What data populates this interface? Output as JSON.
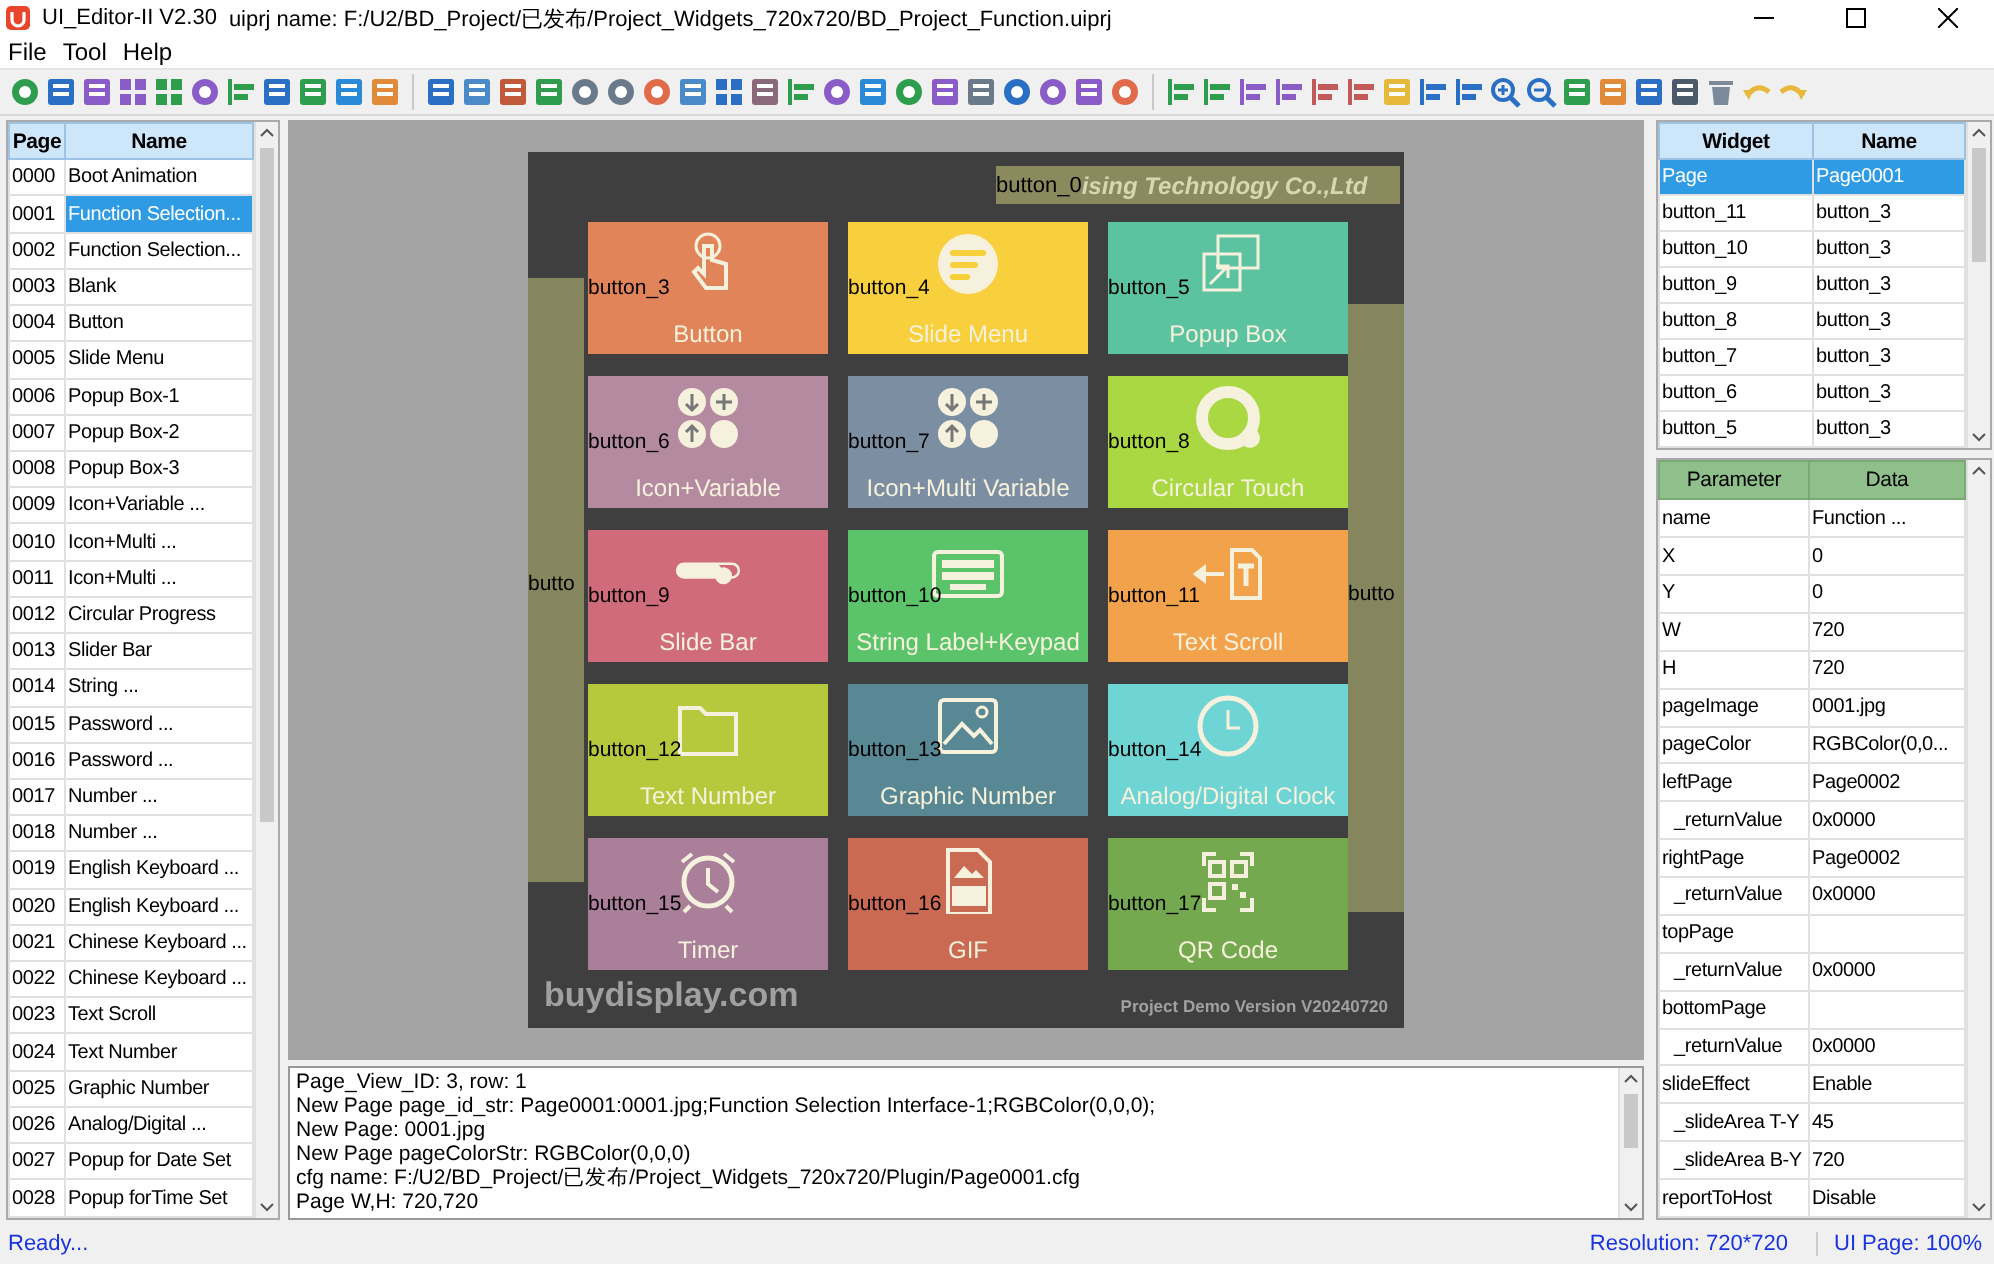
{
  "window": {
    "title": "UI_Editor-II V2.30",
    "project": "uiprj name: F:/U2/BD_Project/已发布/Project_Widgets_720x720/BD_Project_Function.uiprj"
  },
  "menu": [
    "File",
    "Tool",
    "Help"
  ],
  "pages": {
    "columns": [
      "Page",
      "Name"
    ],
    "rows": [
      {
        "page": "0000",
        "name": "Boot Animation",
        "selected": false
      },
      {
        "page": "0001",
        "name": "Function Selection...",
        "selected": true
      },
      {
        "page": "0002",
        "name": "Function Selection...",
        "selected": false
      },
      {
        "page": "0003",
        "name": "Blank",
        "selected": false
      },
      {
        "page": "0004",
        "name": "Button",
        "selected": false
      },
      {
        "page": "0005",
        "name": "Slide Menu",
        "selected": false
      },
      {
        "page": "0006",
        "name": "Popup  Box-1",
        "selected": false
      },
      {
        "page": "0007",
        "name": "Popup  Box-2",
        "selected": false
      },
      {
        "page": "0008",
        "name": "Popup  Box-3",
        "selected": false
      },
      {
        "page": "0009",
        "name": "Icon+Variable ...",
        "selected": false
      },
      {
        "page": "0010",
        "name": "Icon+Multi ...",
        "selected": false
      },
      {
        "page": "0011",
        "name": "Icon+Multi ...",
        "selected": false
      },
      {
        "page": "0012",
        "name": "Circular Progress",
        "selected": false
      },
      {
        "page": "0013",
        "name": "Slider Bar",
        "selected": false
      },
      {
        "page": "0014",
        "name": "String ...",
        "selected": false
      },
      {
        "page": "0015",
        "name": "Password ...",
        "selected": false
      },
      {
        "page": "0016",
        "name": "Password ...",
        "selected": false
      },
      {
        "page": "0017",
        "name": "Number ...",
        "selected": false
      },
      {
        "page": "0018",
        "name": "Number ...",
        "selected": false
      },
      {
        "page": "0019",
        "name": "English Keyboard ...",
        "selected": false
      },
      {
        "page": "0020",
        "name": "English Keyboard ...",
        "selected": false
      },
      {
        "page": "0021",
        "name": "Chinese Keyboard ...",
        "selected": false
      },
      {
        "page": "0022",
        "name": "Chinese Keyboard ...",
        "selected": false
      },
      {
        "page": "0023",
        "name": "Text Scroll",
        "selected": false
      },
      {
        "page": "0024",
        "name": "Text Number",
        "selected": false
      },
      {
        "page": "0025",
        "name": "Graphic Number",
        "selected": false
      },
      {
        "page": "0026",
        "name": "Analog/Digital ...",
        "selected": false
      },
      {
        "page": "0027",
        "name": "Popup for Date Set",
        "selected": false
      },
      {
        "page": "0028",
        "name": "Popup forTime Set",
        "selected": false
      }
    ]
  },
  "canvas": {
    "top_widget": {
      "label": "button_0",
      "text": "ising Technology Co.,Ltd"
    },
    "left_widget": "butto",
    "right_widget": "butto",
    "tiles": [
      {
        "widget": "button_3",
        "label": "Button",
        "color": "#e2845a"
      },
      {
        "widget": "button_4",
        "label": "Slide Menu",
        "color": "#f8cf3c"
      },
      {
        "widget": "button_5",
        "label": "Popup Box",
        "color": "#5cc3a0"
      },
      {
        "widget": "button_6",
        "label": "Icon+Variable",
        "color": "#b48aa0"
      },
      {
        "widget": "button_7",
        "label": "Icon+Multi Variable",
        "color": "#7b8ea2"
      },
      {
        "widget": "button_8",
        "label": "Circular Touch",
        "color": "#a9d843"
      },
      {
        "widget": "button_9",
        "label": "Slide Bar",
        "color": "#cf6b7a"
      },
      {
        "widget": "button_10",
        "label": "String Label+Keypad",
        "color": "#5bc46a"
      },
      {
        "widget": "button_11",
        "label": "Text Scroll",
        "color": "#f3a24c"
      },
      {
        "widget": "button_12",
        "label": "Text Number",
        "color": "#b6c93c"
      },
      {
        "widget": "button_13",
        "label": "Graphic Number",
        "color": "#578893"
      },
      {
        "widget": "button_14",
        "label": "Analog/Digital Clock",
        "color": "#6fd4d4"
      },
      {
        "widget": "button_15",
        "label": "Timer",
        "color": "#a97f99"
      },
      {
        "widget": "button_16",
        "label": "GIF",
        "color": "#cb6a52"
      },
      {
        "widget": "button_17",
        "label": "QR Code",
        "color": "#74a94f"
      }
    ],
    "footer_left": "buydisplay.com",
    "footer_right": "Project Demo Version V20240720"
  },
  "log": [
    "Page_View_ID: 3, row: 1",
    "New Page page_id_str: Page0001:0001.jpg;Function Selection Interface-1;RGBColor(0,0,0);",
    "New Page: 0001.jpg",
    "New Page pageColorStr: RGBColor(0,0,0)",
    "cfg name: F:/U2/BD_Project/已发布/Project_Widgets_720x720/Plugin/Page0001.cfg",
    "Page W,H: 720,720"
  ],
  "widgets": {
    "columns": [
      "Widget",
      "Name"
    ],
    "rows": [
      {
        "widget": "Page",
        "name": "Page0001",
        "selected": true
      },
      {
        "widget": "button_11",
        "name": "button_3",
        "selected": false
      },
      {
        "widget": "button_10",
        "name": "button_3",
        "selected": false
      },
      {
        "widget": "button_9",
        "name": "button_3",
        "selected": false
      },
      {
        "widget": "button_8",
        "name": "button_3",
        "selected": false
      },
      {
        "widget": "button_7",
        "name": "button_3",
        "selected": false
      },
      {
        "widget": "button_6",
        "name": "button_3",
        "selected": false
      },
      {
        "widget": "button_5",
        "name": "button_3",
        "selected": false
      }
    ]
  },
  "parameters": {
    "columns": [
      "Parameter",
      "Data"
    ],
    "rows": [
      {
        "name": "name",
        "value": "Function ..."
      },
      {
        "name": "X",
        "value": "0"
      },
      {
        "name": "Y",
        "value": "0"
      },
      {
        "name": "W",
        "value": "720"
      },
      {
        "name": "H",
        "value": "720"
      },
      {
        "name": "pageImage",
        "value": "0001.jpg"
      },
      {
        "name": "pageColor",
        "value": "RGBColor(0,0..."
      },
      {
        "name": "leftPage",
        "value": "Page0002",
        "children": [
          {
            "name": "_returnValue",
            "value": "0x0000"
          }
        ]
      },
      {
        "name": "rightPage",
        "value": "Page0002",
        "children": [
          {
            "name": "_returnValue",
            "value": "0x0000"
          }
        ]
      },
      {
        "name": "topPage",
        "children": [
          {
            "name": "_returnValue",
            "value": "0x0000"
          }
        ]
      },
      {
        "name": "bottomPage",
        "children": [
          {
            "name": "_returnValue",
            "value": "0x0000"
          }
        ]
      },
      {
        "name": "slideEffect",
        "value": "Enable",
        "children": [
          {
            "name": "_slideArea T-Y",
            "value": "45"
          },
          {
            "name": "_slideArea B-Y",
            "value": "720"
          }
        ]
      },
      {
        "name": "reportToHost",
        "value": "Disable"
      }
    ]
  },
  "status": {
    "message": "Ready...",
    "resolution": "Resolution: 720*720",
    "zoom": "UI Page: 100%"
  }
}
